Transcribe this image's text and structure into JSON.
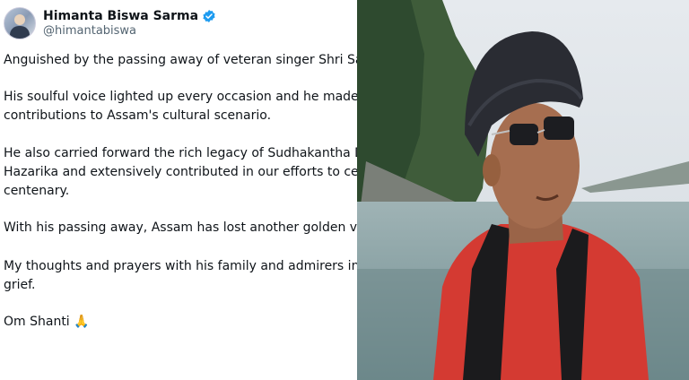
{
  "tweet": {
    "display_name": "Himanta Biswa Sarma",
    "handle": "@himantabiswa",
    "paragraphs": [
      "Anguished by the passing away of veteran singer Shri Sam",
      "His soulful voice lighted up every occasion and he made in\ncontributions to Assam's cultural scenario.",
      "He also carried forward the rich legacy of Sudhakantha Dr.\nHazarika and extensively contributed in our efforts to celeb\ncentenary.",
      "With his passing away, Assam has lost another golden voic",
      "My thoughts and prayers with his family and admirers in th\ngrief.",
      "Om Shanti 🙏"
    ],
    "verified_icon": "verified-badge-icon",
    "accent_color": "#1d9bf0"
  },
  "photo": {
    "subject": "man-in-red-shirt-portrait"
  }
}
